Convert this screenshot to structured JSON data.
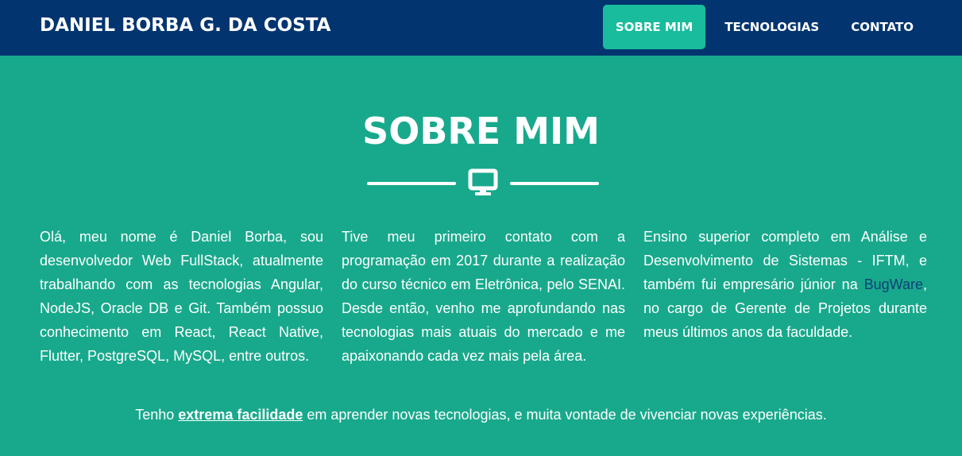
{
  "navbar": {
    "brand": "DANIEL BORBA G. DA COSTA",
    "links": [
      {
        "label": "SOBRE MIM",
        "active": true
      },
      {
        "label": "TECNOLOGIAS",
        "active": false
      },
      {
        "label": "CONTATO",
        "active": false
      }
    ]
  },
  "about": {
    "title": "SOBRE MIM",
    "divider_icon": "monitor-icon",
    "col1": "Olá, meu nome é Daniel Borba, sou desenvolvedor Web FullStack, atualmente trabalhando com as tecnologias Angular, NodeJS, Oracle DB e Git. Também possuo conhecimento em React, React Native, Flutter, PostgreSQL, MySQL, entre outros.",
    "col2": "Tive meu primeiro contato com a programação em 2017 durante a realização do curso técnico em Eletrônica, pelo SENAI. Desde então, venho me aprofundando nas tecnologias mais atuais do mercado e me apaixonando cada vez mais pela área.",
    "col3_before_link": "Ensino superior completo em Análise e Desenvolvimento de Sistemas - IFTM, e também fui empresário júnior na ",
    "col3_link": "BugWare",
    "col3_after_link": ", no cargo de Gerente de Projetos durante meus últimos anos da faculdade.",
    "tagline_before": "Tenho ",
    "tagline_emphasis": "extrema facilidade",
    "tagline_after": " em aprender novas tecnologias, e muita vontade de vivenciar novas experiências."
  },
  "colors": {
    "navbar_bg": "#023570",
    "page_bg": "#18a98c",
    "active_nav_bg": "#19bc9c",
    "link": "#0d3f74"
  }
}
